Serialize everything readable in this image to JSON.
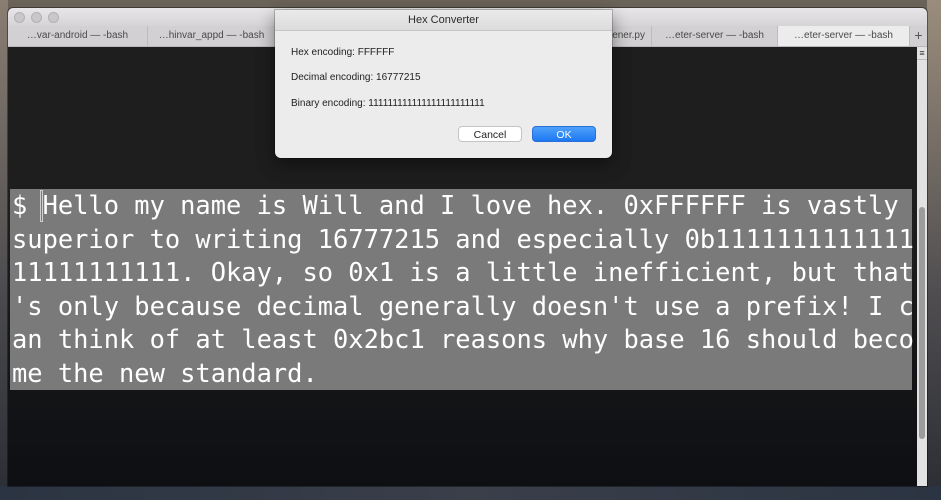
{
  "terminal": {
    "tabs": [
      {
        "label": "…var-android — -bash",
        "active": false
      },
      {
        "label": "…hinvar_appd — -bash",
        "active": false
      },
      {
        "label": "",
        "active": false
      },
      {
        "label": "…ener.py",
        "active": false
      },
      {
        "label": "…eter-server — -bash",
        "active": false
      },
      {
        "label": "…eter-server — -bash",
        "active": true
      }
    ],
    "add_tab_label": "+",
    "lines": [
      "$ Hello my name is Will and I love hex. 0xFFFFFF is vastly",
      "superior to writing 16777215 and especially 0b1111111111111",
      "11111111111. Okay, so 0x1 is a little inefficient, but that",
      "'s only because decimal generally doesn't use a prefix! I c",
      "an think of at least 0x2bc1 reasons why base 16 should beco",
      "me the new standard."
    ]
  },
  "dialog": {
    "title": "Hex Converter",
    "hex_line": "Hex encoding: FFFFFF",
    "decimal_line": "Decimal encoding: 16777215",
    "binary_line": "Binary encoding: 111111111111111111111111",
    "cancel_label": "Cancel",
    "ok_label": "OK"
  },
  "colors": {
    "selection": "#7a7a7a",
    "ok_button": "#1d78f2"
  }
}
